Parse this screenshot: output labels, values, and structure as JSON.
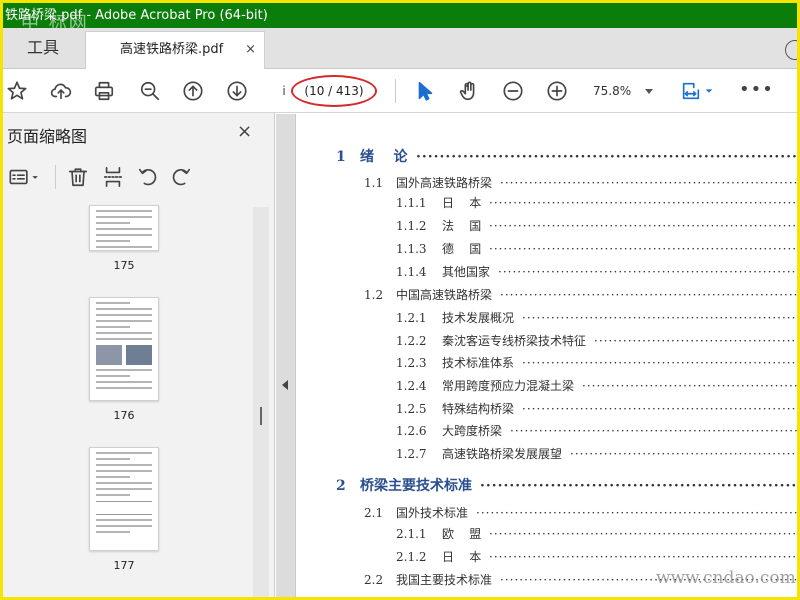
{
  "window": {
    "title": "铁路桥梁.pdf - Adobe Acrobat Pro (64-bit)"
  },
  "watermark_top": "中 标网",
  "watermark_bottom": "www.cndao.com",
  "tabs": {
    "tools": "工具",
    "document": "高速铁路桥梁.pdf",
    "close": "×"
  },
  "toolbar": {
    "icons": [
      "bookmark-star-icon",
      "upload-cloud-icon",
      "print-icon",
      "zoom-search-icon",
      "page-up-icon",
      "page-down-icon",
      "select-cursor-icon",
      "hand-icon",
      "zoom-out-icon",
      "zoom-in-icon",
      "fit-page-icon",
      "more-icon"
    ],
    "page_input": "i",
    "page_count": "(10 / 413)",
    "zoom": "75.8%",
    "more": "•••"
  },
  "panel": {
    "title": "页面缩略图",
    "close": "×",
    "tool_icons": [
      "options-icon",
      "delete-icon",
      "insert-icon",
      "undo-icon",
      "redo-icon"
    ],
    "thumbnails": [
      {
        "page": "175"
      },
      {
        "page": "176"
      },
      {
        "page": "177"
      }
    ]
  },
  "toc": [
    {
      "level": 1,
      "num": "1",
      "title": "绪    论"
    },
    {
      "level": 2,
      "num": "1.1",
      "title": "国外高速铁路桥梁"
    },
    {
      "level": 3,
      "num": "1.1.1",
      "title": "日    本"
    },
    {
      "level": 3,
      "num": "1.1.2",
      "title": "法    国"
    },
    {
      "level": 3,
      "num": "1.1.3",
      "title": "德    国"
    },
    {
      "level": 3,
      "num": "1.1.4",
      "title": "其他国家"
    },
    {
      "level": 2,
      "num": "1.2",
      "title": "中国高速铁路桥梁"
    },
    {
      "level": 3,
      "num": "1.2.1",
      "title": "技术发展概况"
    },
    {
      "level": 3,
      "num": "1.2.2",
      "title": "秦沈客运专线桥梁技术特征"
    },
    {
      "level": 3,
      "num": "1.2.3",
      "title": "技术标准体系"
    },
    {
      "level": 3,
      "num": "1.2.4",
      "title": "常用跨度预应力混凝土梁"
    },
    {
      "level": 3,
      "num": "1.2.5",
      "title": "特殊结构桥梁"
    },
    {
      "level": 3,
      "num": "1.2.6",
      "title": "大跨度桥梁"
    },
    {
      "level": 3,
      "num": "1.2.7",
      "title": "高速铁路桥梁发展展望"
    },
    {
      "level": 1,
      "num": "2",
      "title": "桥梁主要技术标准"
    },
    {
      "level": 2,
      "num": "2.1",
      "title": "国外技术标准"
    },
    {
      "level": 3,
      "num": "2.1.1",
      "title": "欧    盟"
    },
    {
      "level": 3,
      "num": "2.1.2",
      "title": "日    本"
    },
    {
      "level": 2,
      "num": "2.2",
      "title": "我国主要技术标准"
    }
  ]
}
